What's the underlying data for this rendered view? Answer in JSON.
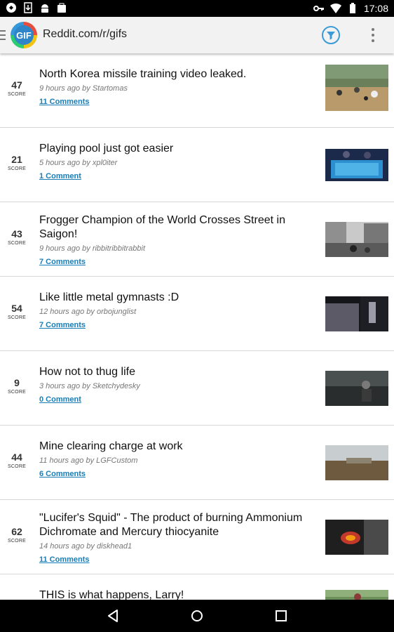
{
  "status_bar": {
    "time": "17:08"
  },
  "app_bar": {
    "title": "Reddit.com/r/gifs"
  },
  "score_label": "SCORE",
  "posts": [
    {
      "score": "47",
      "title": "North Korea missile training video leaked.",
      "meta": "9 hours ago by Startomas",
      "comments": "11 Comments"
    },
    {
      "score": "21",
      "title": "Playing pool just got easier",
      "meta": "5 hours ago by xpl0iter",
      "comments": "1 Comment"
    },
    {
      "score": "43",
      "title": "Frogger Champion of the World Crosses Street in Saigon!",
      "meta": "9 hours ago by ribbitribbitrabbit",
      "comments": "7 Comments"
    },
    {
      "score": "54",
      "title": "Like little metal gymnasts :D",
      "meta": "12 hours ago by orbojunglist",
      "comments": "7 Comments"
    },
    {
      "score": "9",
      "title": "How not to thug life",
      "meta": "3 hours ago by Sketchydesky",
      "comments": "0 Comment"
    },
    {
      "score": "44",
      "title": "Mine clearing charge at work",
      "meta": "11 hours ago by LGFCustom",
      "comments": "6 Comments"
    },
    {
      "score": "62",
      "title": "\"Lucifer's Squid\" - The product of burning Ammonium Dichromate and Mercury thiocyanite",
      "meta": "14 hours ago by diskhead1",
      "comments": "11 Comments"
    },
    {
      "score": "",
      "title": "THIS is what happens, Larry!",
      "meta": "",
      "comments": ""
    }
  ]
}
